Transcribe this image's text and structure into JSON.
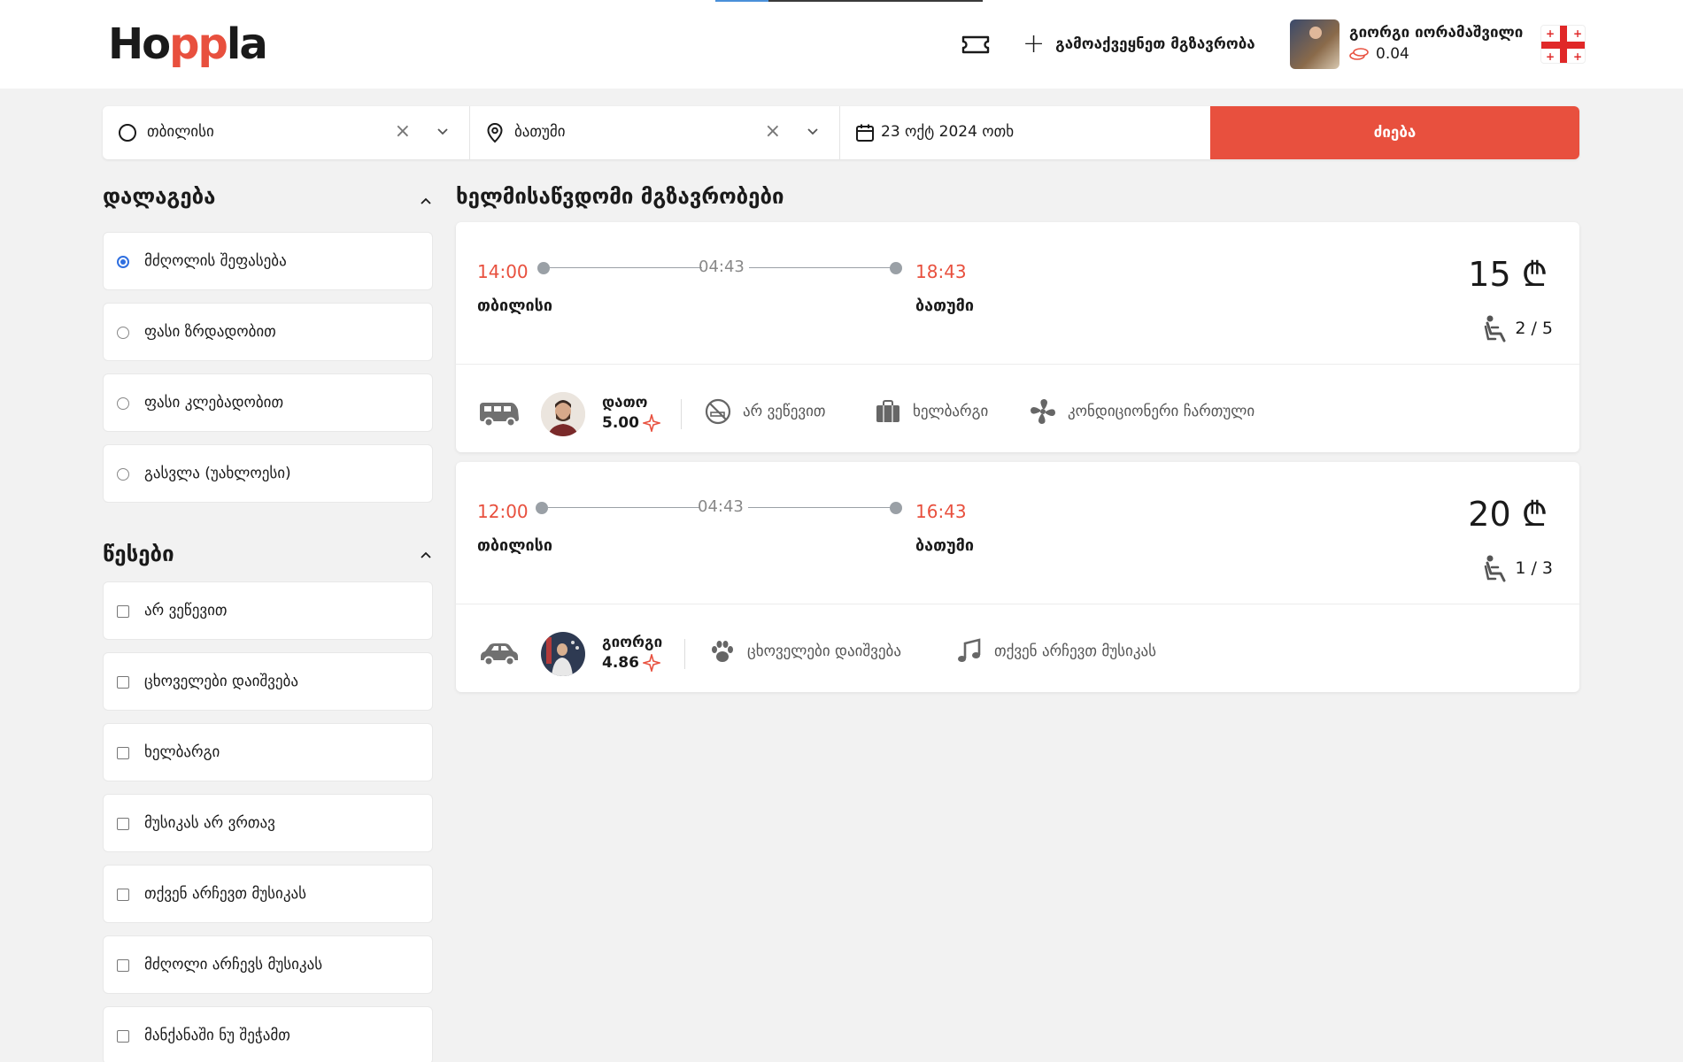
{
  "header": {
    "logo": "Hoppla",
    "publish_label": "გამოაქვეყნეთ მგზავრობა",
    "user_name": "გიორგი იორამაშვილი",
    "balance": "0.04"
  },
  "search": {
    "from": "თბილისი",
    "to": "ბათუმი",
    "date": "23 ოქტ 2024 ოთხ",
    "button": "ძიება"
  },
  "sort": {
    "title": "დალაგება",
    "options": [
      {
        "label": "მძღოლის შეფასება",
        "selected": true
      },
      {
        "label": "ფასი ზრდადობით",
        "selected": false
      },
      {
        "label": "ფასი კლებადობით",
        "selected": false
      },
      {
        "label": "გასვლა (უახლოესი)",
        "selected": false
      }
    ]
  },
  "rules": {
    "title": "წესები",
    "options": [
      "არ ვეწევით",
      "ცხოველები დაიშვება",
      "ხელბარგი",
      "მუსიკას არ ვრთავ",
      "თქვენ არჩევთ მუსიკას",
      "მძღოლი არჩევს მუსიკას",
      "მანქანაში ნუ შეჭამთ"
    ]
  },
  "results": {
    "title": "ხელმისაწვდომი მგზავრობები",
    "trips": [
      {
        "dep_time": "14:00",
        "duration": "04:43",
        "arr_time": "18:43",
        "from": "თბილისი",
        "to": "ბათუმი",
        "price": "15 ₾",
        "seats": "2 / 5",
        "vehicle_icon": "van-icon",
        "driver_name": "დათო",
        "driver_rating": "5.00",
        "features": [
          {
            "icon": "no-smoking-icon",
            "label": "არ ვეწევით"
          },
          {
            "icon": "bag-icon",
            "label": "ხელბარგი"
          },
          {
            "icon": "fan-icon",
            "label": "კონდიციონერი ჩართული"
          }
        ]
      },
      {
        "dep_time": "12:00",
        "duration": "04:43",
        "arr_time": "16:43",
        "from": "თბილისი",
        "to": "ბათუმი",
        "price": "20 ₾",
        "seats": "1 / 3",
        "vehicle_icon": "car-icon",
        "driver_name": "გიორგი",
        "driver_rating": "4.86",
        "features": [
          {
            "icon": "paw-icon",
            "label": "ცხოველები დაიშვება"
          },
          {
            "icon": "music-icon",
            "label": "თქვენ არჩევთ მუსიკას"
          }
        ]
      }
    ]
  },
  "colors": {
    "accent": "#e8503e",
    "background": "#f2f2f2",
    "radio_selected": "#2f6fe0"
  }
}
